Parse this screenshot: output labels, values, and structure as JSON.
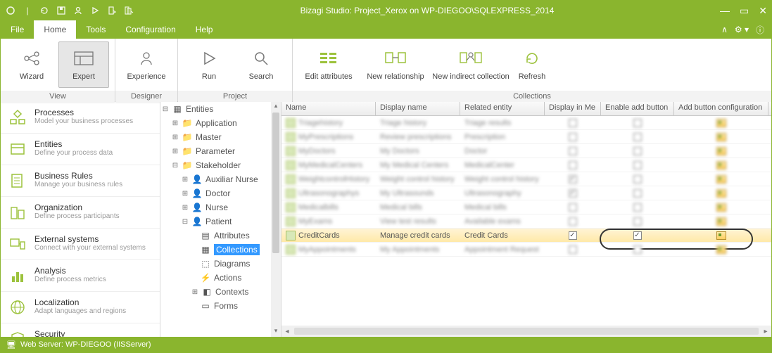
{
  "title": "Bizagi Studio: Project_Xerox  on WP-DIEGOO\\SQLEXPRESS_2014",
  "menu": {
    "file": "File",
    "home": "Home",
    "tools": "Tools",
    "config": "Configuration",
    "help": "Help"
  },
  "ribbon": {
    "groups": {
      "view": "View",
      "designer": "Designer",
      "project": "Project",
      "collections": "Collections"
    },
    "wizard": "Wizard",
    "expert": "Expert",
    "experience": "Experience",
    "run": "Run",
    "search": "Search",
    "edit_attributes": "Edit attributes",
    "new_relationship": "New relationship",
    "new_indirect": "New indirect collection",
    "refresh": "Refresh"
  },
  "nav": {
    "processes": {
      "title": "Processes",
      "sub": "Model your business processes"
    },
    "entities": {
      "title": "Entities",
      "sub": "Define your process data"
    },
    "rules": {
      "title": "Business  Rules",
      "sub": "Manage your business rules"
    },
    "org": {
      "title": "Organization",
      "sub": "Define process participants"
    },
    "ext": {
      "title": "External systems",
      "sub": "Connect with your external systems"
    },
    "analysis": {
      "title": "Analysis",
      "sub": "Define process metrics"
    },
    "local": {
      "title": "Localization",
      "sub": "Adapt languages and regions"
    },
    "security": {
      "title": "Security",
      "sub": ""
    }
  },
  "tree": {
    "root": "Entities",
    "application": "Application",
    "master": "Master",
    "parameter": "Parameter",
    "stakeholder": "Stakeholder",
    "aux_nurse": "Auxiliar Nurse",
    "doctor": "Doctor",
    "nurse": "Nurse",
    "patient": "Patient",
    "attributes": "Attributes",
    "collections": "Collections",
    "diagrams": "Diagrams",
    "actions": "Actions",
    "contexts": "Contexts",
    "forms": "Forms"
  },
  "grid": {
    "headers": {
      "name": "Name",
      "display": "Display name",
      "related": "Related entity",
      "display_in_me": "Display in Me",
      "enable_add": "Enable add button",
      "add_config": "Add button configuration"
    },
    "rows": [
      {
        "name": "Triagehistory",
        "display": "Triage history",
        "related": "Triage results",
        "dim": false,
        "blur": true
      },
      {
        "name": "MyPrescriptions",
        "display": "Review prescriptions",
        "related": "Prescription",
        "dim": false,
        "blur": true
      },
      {
        "name": "MyDoctors",
        "display": "My Doctors",
        "related": "Doctor",
        "dim": false,
        "blur": true
      },
      {
        "name": "MyMedicalCenters",
        "display": "My Medical Centers",
        "related": "MedicalCenter",
        "dim": false,
        "blur": true
      },
      {
        "name": "WeightcontrolHistory",
        "display": "Weight control history",
        "related": "Weight control history",
        "dim": true,
        "blur": true
      },
      {
        "name": "Ultrasonographys",
        "display": "My Ultrasounds",
        "related": "Ultrasonography",
        "dim": true,
        "blur": true
      },
      {
        "name": "Medicalbills",
        "display": "Medical bills",
        "related": "Medical bills",
        "dim": false,
        "blur": true
      },
      {
        "name": "MyExams",
        "display": "View test results",
        "related": "Available exams",
        "dim": false,
        "blur": true
      },
      {
        "name": "CreditCards",
        "display": "Manage credit cards",
        "related": "Credit Cards",
        "dim": true,
        "eab": true,
        "hl": true
      },
      {
        "name": "MyAppointments",
        "display": "My Appointments",
        "related": "Appointment Request",
        "dim": false,
        "blur": true
      }
    ]
  },
  "status": {
    "text": "Web Server: WP-DIEGOO (IISServer)"
  }
}
